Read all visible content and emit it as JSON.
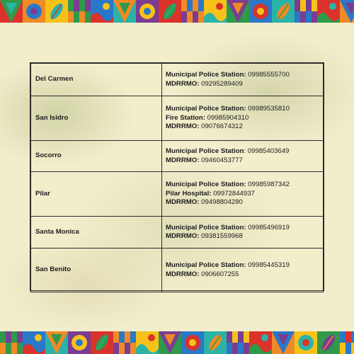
{
  "rows": [
    {
      "town": "Del Carmen",
      "contacts": [
        {
          "label": "Municipal Police Station:",
          "sep": " ",
          "number": "09985555700"
        },
        {
          "label": "MDRRMO:",
          "sep": " ",
          "number": "09295289409"
        }
      ]
    },
    {
      "town": "San Isidro",
      "contacts": [
        {
          "label": "Municipal Police Station:",
          "sep": " ",
          "number": "09989535810"
        },
        {
          "label": "Fire Station:",
          "sep": " ",
          "number": "09985904310"
        },
        {
          "label": "MDRRMO:",
          "sep": " ",
          "number": "09076674312"
        }
      ]
    },
    {
      "town": "Socorro",
      "contacts": [
        {
          "label": "Municipal Police Station",
          "sep": ": ",
          "number": "09985403649"
        },
        {
          "label": "MDRRMO:",
          "sep": " ",
          "number": "09460453777"
        }
      ]
    },
    {
      "town": "Pilar",
      "contacts": [
        {
          "label": "Municipal Police Station:",
          "sep": " ",
          "number": "09985987342"
        },
        {
          "label": "Pilar Hospital:",
          "sep": " ",
          "number": "09972844937"
        },
        {
          "label": "MDRRMO:",
          "sep": " ",
          "number": "09498804280"
        }
      ]
    },
    {
      "town": "Santa Monica",
      "contacts": [
        {
          "label": "Municipal Police Station:",
          "sep": " ",
          "number": "09985496919"
        },
        {
          "label": "MDRRMO:",
          "sep": " ",
          "number": "09381559968"
        }
      ]
    },
    {
      "town": "San Benito",
      "contacts": [
        {
          "label": "Municipal Police Station:",
          "sep": " ",
          "number": "09985445319"
        },
        {
          "label": "MDRRMO:",
          "sep": " ",
          "number": "0906607255"
        }
      ]
    }
  ],
  "colors": {
    "background": "#f2eecc",
    "table_border": "#2b2b2b",
    "text": "#1c1c1c",
    "band_red": "#d9332b",
    "band_orange": "#f08a24",
    "band_yellow": "#f6c21a",
    "band_green": "#2f9a4a",
    "band_blue": "#2a78c8",
    "band_teal": "#2bb3a8",
    "band_purple": "#7a3d91"
  },
  "decor": {
    "top_band_icons": [
      "triangle-pattern-icon",
      "leaf-icon",
      "flower-icon",
      "palm-tree-icon",
      "church-icon",
      "pizza-icon",
      "fish-icon",
      "surfer-icon",
      "fish-icon"
    ],
    "bottom_band_icons": [
      "triangle-pattern-icon",
      "mango-icon",
      "sun-pattern-icon",
      "leaf-icon",
      "fan-icon",
      "mask-icon",
      "wave-pattern-icon"
    ]
  }
}
